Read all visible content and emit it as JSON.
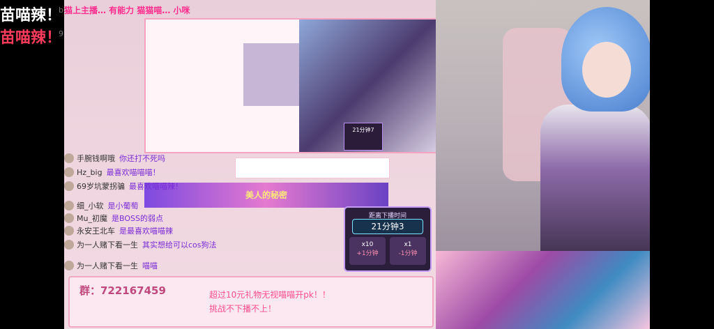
{
  "outer": {
    "brand_line1": "苗喵辣！",
    "brand_line2": "苗喵辣！",
    "watermark1": "bili",
    "watermark2": "9"
  },
  "scroll_notice": "猫上主播…  有能力 猫猫喵…  小咪",
  "chat": {
    "messages": [
      {
        "user": "手腕钱啊哦",
        "text": "你还打不死吗"
      },
      {
        "user": "Hz_big",
        "text": "最喜欢喵喵喵！"
      },
      {
        "user": "69岁坑蒙拐骗",
        "text": "最喜欢喵喵辣！"
      },
      {
        "user": "细_小软",
        "text": "是小葡萄"
      },
      {
        "user": "Mu_初魔",
        "text": "是BOSS的弱点"
      },
      {
        "user": "永安王北车",
        "text": "是最喜欢喵喵辣"
      },
      {
        "user": "为一人赌下看一生",
        "text": "其实想给可以cos狗法"
      },
      {
        "user": "为一人赌下看一生",
        "text": "喵喵"
      }
    ]
  },
  "banner_text": "美人的秘密",
  "nested_timer": "21分钟7",
  "timer": {
    "title": "距离下播时间",
    "value": "21分钟3",
    "item1": {
      "count": "x10",
      "label": "+1分钟"
    },
    "item2": {
      "count": "x1",
      "label": "-1分钟"
    }
  },
  "bottom": {
    "group": "群：722167459",
    "notice1": "超过10元礼物无视喵喵开pk！！",
    "notice2": "挑战不下播不上！"
  },
  "colors": {
    "frame_pink": "#f7d6e2",
    "accent_magenta": "#ff4d8f",
    "timer_bg": "#2a1e3b"
  }
}
